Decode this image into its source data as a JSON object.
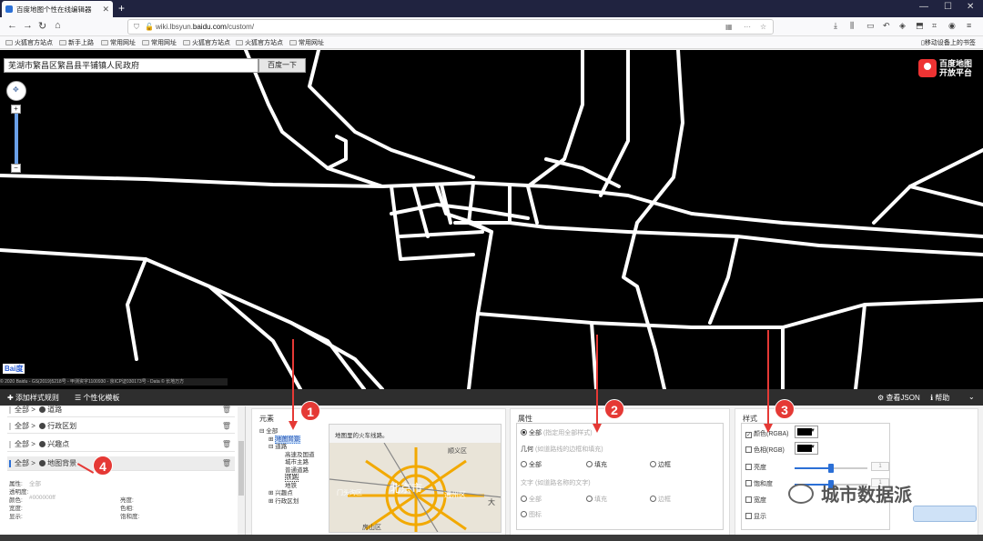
{
  "browser": {
    "tab_title": "百度地图个性在线编辑器",
    "url_prefix": "wiki.lbsyun.",
    "url_domain": "baidu.com",
    "url_path": "/custom/",
    "bookmarks": [
      "火狐官方站点",
      "新手上路",
      "常用网址",
      "常用网址",
      "火狐官方站点",
      "火狐官方站点",
      "常用网址"
    ],
    "mobile_bookmark": "移动设备上的书签"
  },
  "map": {
    "search_value": "芜湖市繁昌区繁昌县平铺镇人民政府",
    "search_button": "百度一下",
    "brand_line1": "百度地图",
    "brand_line2": "开放平台",
    "logo_text": "Bai度",
    "copyright": "© 2020 Baidu - GS(2019)5218号 - 甲测资字1100930 - 京ICP证030173号 - Data © 长地万方"
  },
  "toolbar": {
    "add_rule": "添加样式规则",
    "template": "个性化模板",
    "view_json": "查看JSON",
    "help": "帮助"
  },
  "rules": [
    {
      "path": "全部 > ",
      "name": "道路"
    },
    {
      "path": "全部 > ",
      "name": "行政区划"
    },
    {
      "path": "全部 > ",
      "name": "兴趣点"
    },
    {
      "path": "全部 > ",
      "name": "地图背景"
    }
  ],
  "props": {
    "attr_label": "属性:",
    "attr_value": "全部",
    "opacity_label": "透明度:",
    "color_label": "颜色:",
    "color_value": "#000000ff",
    "lightness_label": "亮度:",
    "width_label": "宽度:",
    "hue_label": "色相:",
    "show_label": "显示:",
    "saturation_label": "饱和度:"
  },
  "elements": {
    "title": "元素",
    "root": "全部",
    "items": [
      "地图背景",
      "道路",
      "高速及国道",
      "城市主路",
      "普通道路",
      "铁路",
      "地铁",
      "兴趣点",
      "行政区划"
    ],
    "preview_caption": "地图里的火车线路。",
    "preview_labels": [
      "顺义区",
      "北京市",
      "门头沟区",
      "通州区",
      "房山区",
      "大"
    ]
  },
  "attributes": {
    "title": "属性",
    "all_label": "全部",
    "all_note": "(指定用全部样式)",
    "geometry_label": "几何",
    "geometry_note": "(如道路线的边框和填充)",
    "geo_options": [
      "全部",
      "填充",
      "边框"
    ],
    "text_label": "文字",
    "text_note": "(如道路名称的文字)",
    "text_options": [
      "全部",
      "填充",
      "边框",
      "图标"
    ]
  },
  "style": {
    "title": "样式",
    "color_label": "颜色(RGBA)",
    "hue_label": "色相(RGB)",
    "lightness_label": "亮度",
    "saturation_label": "饱和度",
    "width_label": "宽度",
    "show_label": "显示",
    "lightness_value": "1",
    "saturation_value": "1",
    "color_hex": "#000000"
  },
  "annotations": [
    "1",
    "2",
    "3",
    "4"
  ],
  "watermark": "城市数据派",
  "colors": {
    "accent": "#2b6fd6",
    "annotation": "#e53935",
    "map_bg": "#000000",
    "road": "#ffffff"
  }
}
